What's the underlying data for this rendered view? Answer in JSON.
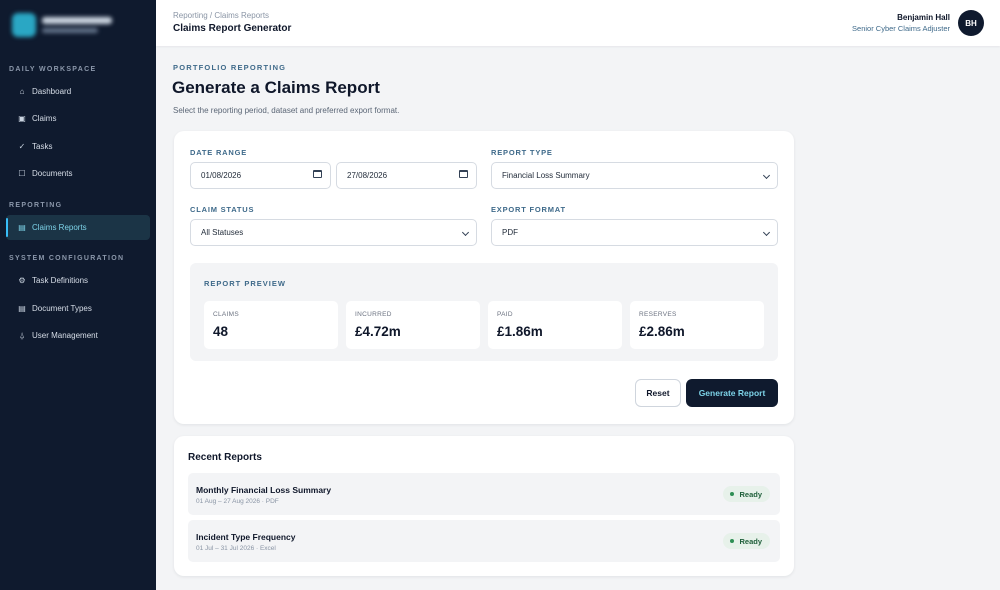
{
  "sidebar": {
    "sections": [
      {
        "title": "DAILY WORKSPACE"
      },
      {
        "title": "REPORTING"
      },
      {
        "title": "SYSTEM CONFIGURATION"
      }
    ],
    "items": [
      {
        "label": "Dashboard",
        "icon": "home-icon",
        "glyph": "⌂"
      },
      {
        "label": "Claims",
        "icon": "claims-icon",
        "glyph": "▣"
      },
      {
        "label": "Tasks",
        "icon": "check-icon",
        "glyph": "✓"
      },
      {
        "label": "Documents",
        "icon": "document-icon",
        "glyph": "☐"
      },
      {
        "label": "Claims Reports",
        "icon": "report-icon",
        "glyph": "▤",
        "active": true
      },
      {
        "label": "Task Definitions",
        "icon": "settings-icon",
        "glyph": "⚙"
      },
      {
        "label": "Document Types",
        "icon": "list-icon",
        "glyph": "▤"
      },
      {
        "label": "User Management",
        "icon": "user-icon",
        "glyph": "⍙"
      }
    ]
  },
  "header": {
    "breadcrumb": "Reporting / Claims Reports",
    "title": "Claims Report Generator",
    "user": {
      "name": "Benjamin Hall",
      "role": "Senior Cyber Claims Adjuster",
      "initials": "BH"
    }
  },
  "page": {
    "eyebrow": "PORTFOLIO REPORTING",
    "title": "Generate a Claims Report",
    "subtitle": "Select the reporting period, dataset and preferred export format."
  },
  "form": {
    "date_range_label": "DATE RANGE",
    "date_from": "01/08/2026",
    "date_to": "27/08/2026",
    "report_type_label": "REPORT TYPE",
    "report_type_value": "Financial Loss Summary",
    "claim_status_label": "CLAIM STATUS",
    "claim_status_value": "All Statuses",
    "export_format_label": "EXPORT FORMAT",
    "export_format_value": "PDF"
  },
  "preview": {
    "label": "REPORT PREVIEW",
    "metrics": [
      {
        "label": "CLAIMS",
        "value": "48"
      },
      {
        "label": "INCURRED",
        "value": "£4.72m"
      },
      {
        "label": "PAID",
        "value": "£1.86m"
      },
      {
        "label": "RESERVES",
        "value": "£2.86m"
      }
    ]
  },
  "actions": {
    "reset": "Reset",
    "generate": "Generate Report"
  },
  "recent": {
    "title": "Recent Reports",
    "reports": [
      {
        "name": "Monthly Financial Loss Summary",
        "meta": "01 Aug – 27 Aug 2026 · PDF",
        "status": "Ready"
      },
      {
        "name": "Incident Type Frequency",
        "meta": "01 Jul – 31 Jul 2026 · Excel",
        "status": "Ready"
      }
    ]
  },
  "colors": {
    "sidebar_bg": "#0f1a2e",
    "accent": "#7dd3e8",
    "ready_green": "#2f8f55"
  }
}
